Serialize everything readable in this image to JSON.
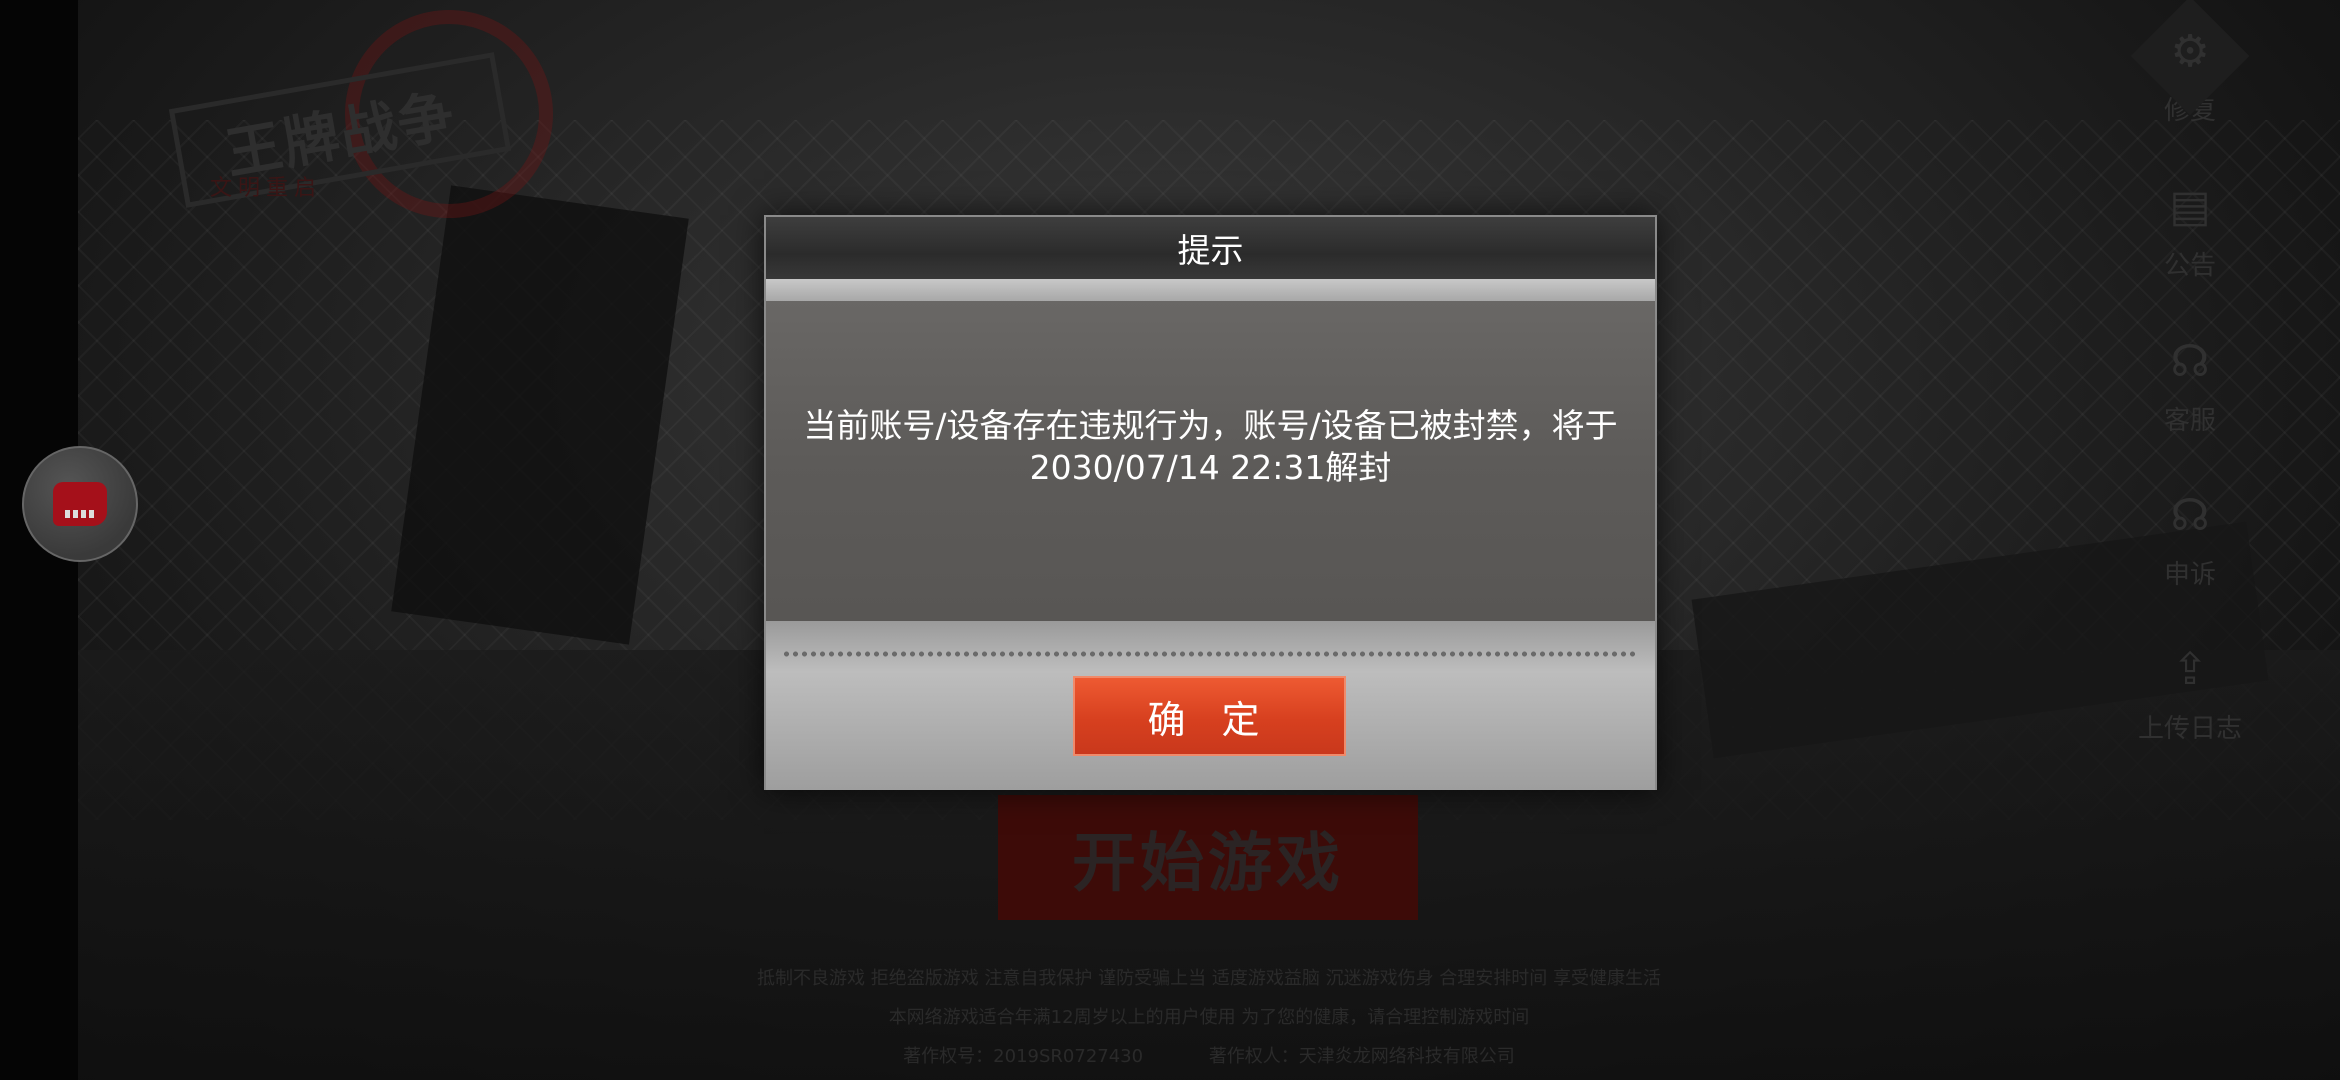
{
  "background": {
    "logo_title": "王牌战争",
    "logo_subtitle": "文明重启",
    "start_button": "开始游戏",
    "notice_line1": "抵制不良游戏 拒绝盗版游戏 注意自我保护 谨防受骗上当 适度游戏益脑 沉迷游戏伤身 合理安排时间 享受健康生活",
    "notice_line2": "本网络游戏适合年满12周岁以上的用户使用    为了您的健康，请合理控制游戏时间",
    "copyright_no": "著作权号：2019SR0727430",
    "copyright_owner": "著作权人：天津炎龙网络科技有限公司"
  },
  "right_menu": [
    {
      "label": "修复",
      "icon": "gear-icon"
    },
    {
      "label": "公告",
      "icon": "notice-icon"
    },
    {
      "label": "客服",
      "icon": "headset-icon"
    },
    {
      "label": "申诉",
      "icon": "headset-icon"
    },
    {
      "label": "上传日志",
      "icon": "upload-icon"
    }
  ],
  "dialog": {
    "title": "提示",
    "message": "当前账号/设备存在违规行为，账号/设备已被封禁，将于2030/07/14 22:31解封",
    "confirm": "确 定"
  },
  "colors": {
    "confirm_button": "#d7401f",
    "dialog_body": "#5f5d5b"
  }
}
